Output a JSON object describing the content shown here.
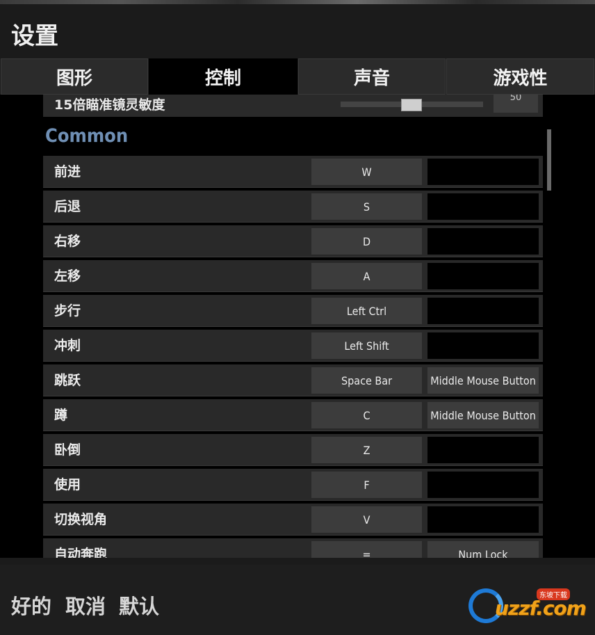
{
  "window": {
    "title": "设置"
  },
  "tabs": [
    {
      "label": "图形"
    },
    {
      "label": "控制"
    },
    {
      "label": "声音"
    },
    {
      "label": "游戏性"
    }
  ],
  "scope_row": {
    "label": "15倍瞄准镜灵敏度",
    "value": "50"
  },
  "section_title": "Common",
  "bindings": [
    {
      "action": "前进",
      "primary": "W",
      "secondary": ""
    },
    {
      "action": "后退",
      "primary": "S",
      "secondary": ""
    },
    {
      "action": "右移",
      "primary": "D",
      "secondary": ""
    },
    {
      "action": "左移",
      "primary": "A",
      "secondary": ""
    },
    {
      "action": "步行",
      "primary": "Left Ctrl",
      "secondary": ""
    },
    {
      "action": "冲刺",
      "primary": "Left Shift",
      "secondary": ""
    },
    {
      "action": "跳跃",
      "primary": "Space Bar",
      "secondary": "Middle Mouse Button"
    },
    {
      "action": "蹲",
      "primary": "C",
      "secondary": "Middle Mouse Button"
    },
    {
      "action": "卧倒",
      "primary": "Z",
      "secondary": ""
    },
    {
      "action": "使用",
      "primary": "F",
      "secondary": ""
    },
    {
      "action": "切换视角",
      "primary": "V",
      "secondary": ""
    },
    {
      "action": "自动奔跑",
      "primary": "=",
      "secondary": "Num Lock"
    }
  ],
  "footer": {
    "ok": "好的",
    "cancel": "取消",
    "default": "默认"
  },
  "watermark": {
    "brand": "uzzf.com",
    "tag": "东坡下载"
  },
  "colors": {
    "section": "#6f8fb4",
    "active_tab": "#000000",
    "key_slot": "#3c3c3c"
  }
}
